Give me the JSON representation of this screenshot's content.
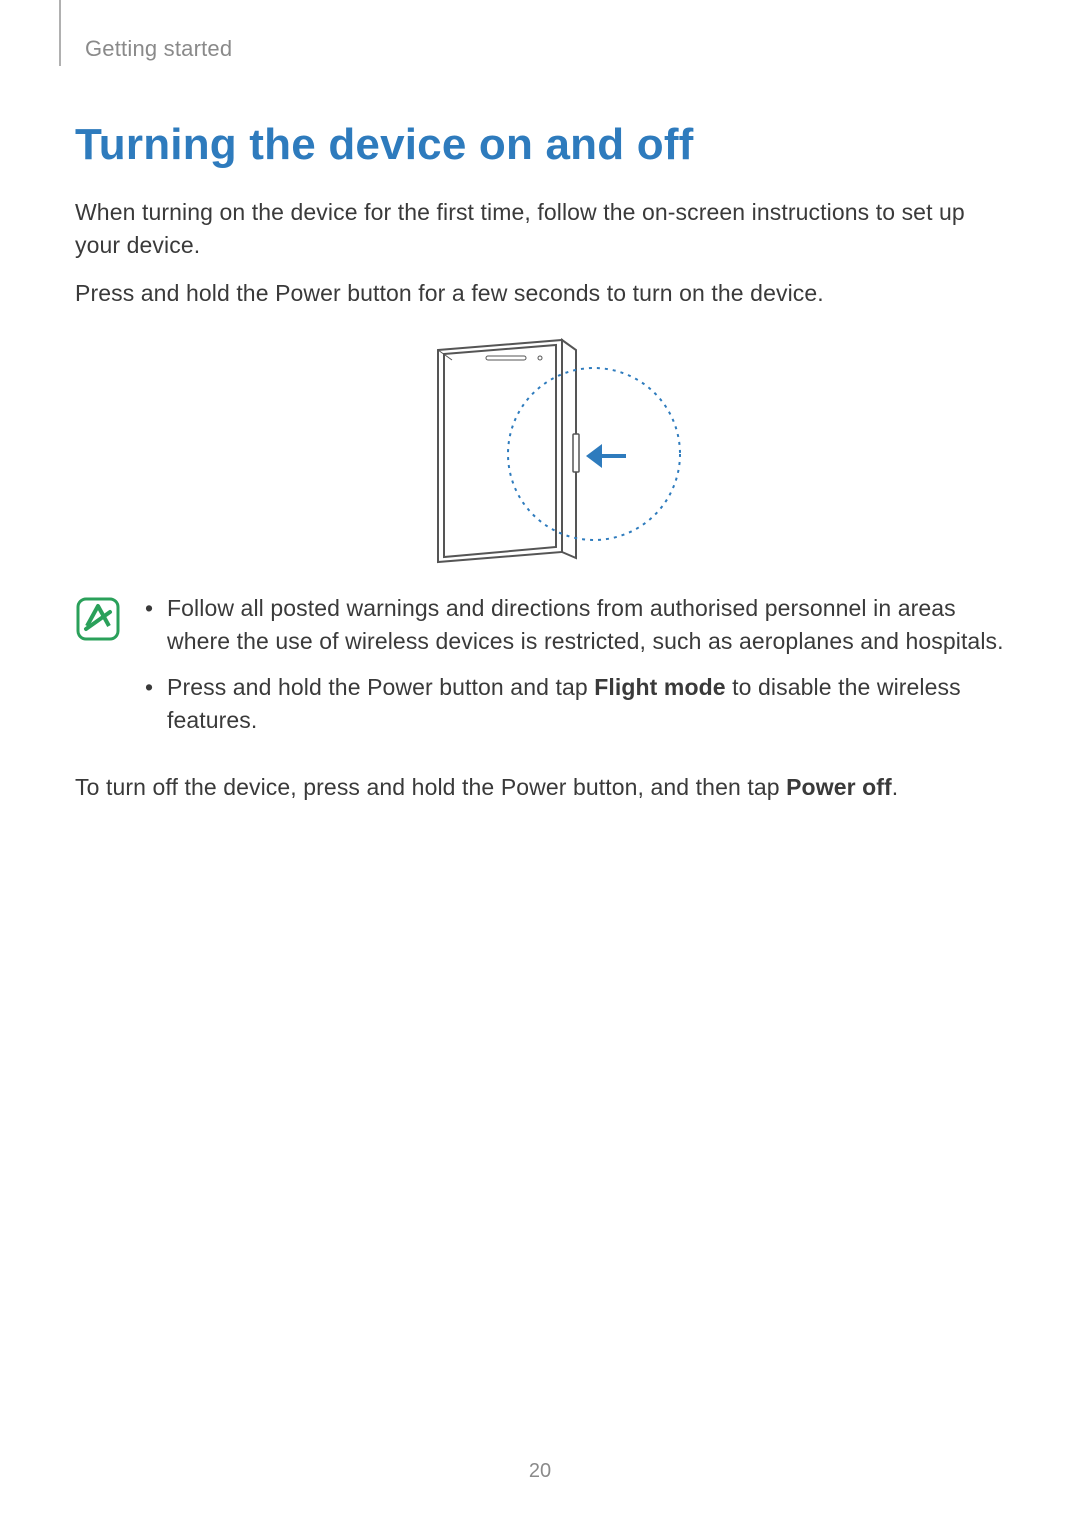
{
  "header": {
    "section": "Getting started"
  },
  "content": {
    "title": "Turning the device on and off",
    "para1": "When turning on the device for the first time, follow the on-screen instructions to set up your device.",
    "para2": "Press and hold the Power button for a few seconds to turn on the device.",
    "note1": "Follow all posted warnings and directions from authorised personnel in areas where the use of wireless devices is restricted, such as aeroplanes and hospitals.",
    "note2_prefix": "Press and hold the Power button and tap ",
    "note2_bold": "Flight mode",
    "note2_suffix": " to disable the wireless features.",
    "para3_prefix": "To turn off the device, press and hold the Power button, and then tap ",
    "para3_bold": "Power off",
    "para3_suffix": "."
  },
  "footer": {
    "page_number": "20"
  }
}
